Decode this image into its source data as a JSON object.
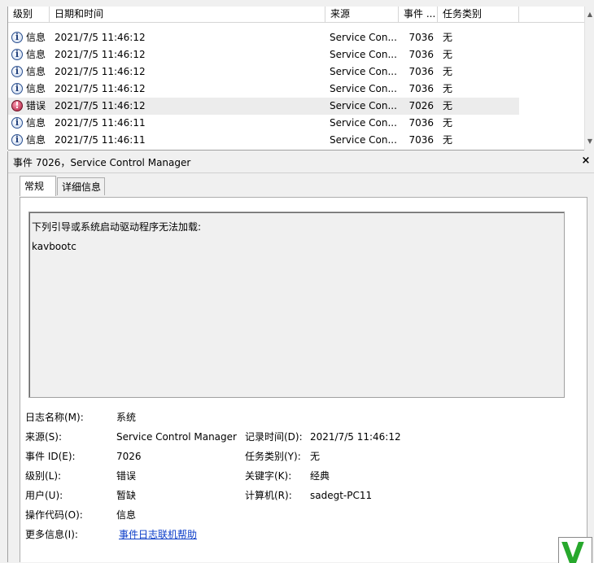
{
  "event_list": {
    "columns": [
      "级别",
      "日期和时间",
      "来源",
      "事件 ...",
      "任务类别"
    ],
    "rows": [
      {
        "level": "信息",
        "level_type": "info",
        "datetime": "2021/7/5 11:46:12",
        "source": "Service Con...",
        "event_id": "7036",
        "task": "无"
      },
      {
        "level": "信息",
        "level_type": "info",
        "datetime": "2021/7/5 11:46:12",
        "source": "Service Con...",
        "event_id": "7036",
        "task": "无"
      },
      {
        "level": "信息",
        "level_type": "info",
        "datetime": "2021/7/5 11:46:12",
        "source": "Service Con...",
        "event_id": "7036",
        "task": "无"
      },
      {
        "level": "信息",
        "level_type": "info",
        "datetime": "2021/7/5 11:46:12",
        "source": "Service Con...",
        "event_id": "7036",
        "task": "无"
      },
      {
        "level": "错误",
        "level_type": "error",
        "datetime": "2021/7/5 11:46:12",
        "source": "Service Con...",
        "event_id": "7026",
        "task": "无",
        "selected": true
      },
      {
        "level": "信息",
        "level_type": "info",
        "datetime": "2021/7/5 11:46:11",
        "source": "Service Con...",
        "event_id": "7036",
        "task": "无"
      },
      {
        "level": "信息",
        "level_type": "info",
        "datetime": "2021/7/5 11:46:11",
        "source": "Service Con...",
        "event_id": "7036",
        "task": "无"
      }
    ]
  },
  "detail": {
    "title": "事件 7026，Service Control Manager",
    "close_glyph": "×",
    "tabs": [
      {
        "label": "常规",
        "active": true
      },
      {
        "label": "详细信息",
        "active": false
      }
    ],
    "description_lines": [
      "下列引导或系统启动驱动程序无法加载:",
      "kavbootc"
    ],
    "fields": {
      "log_name_label": "日志名称(M):",
      "log_name": "系统",
      "source_label": "来源(S):",
      "source": "Service Control Manager",
      "logged_label": "记录时间(D):",
      "logged": "2021/7/5 11:46:12",
      "event_id_label": "事件 ID(E):",
      "event_id": "7026",
      "task_label": "任务类别(Y):",
      "task": "无",
      "level_label": "级别(L):",
      "level": "错误",
      "keywords_label": "关键字(K):",
      "keywords": "经典",
      "user_label": "用户(U):",
      "user": "暂缺",
      "computer_label": "计算机(R):",
      "computer": "sadegt-PC11",
      "opcode_label": "操作代码(O):",
      "opcode": "信息",
      "more_info_label": "更多信息(I):",
      "more_info_link": "事件日志联机帮助"
    }
  },
  "colors": {
    "link": "#0a3cc8",
    "selected_row": "#ececec",
    "logo": "#27a82c"
  },
  "corner_logo_text": "V"
}
